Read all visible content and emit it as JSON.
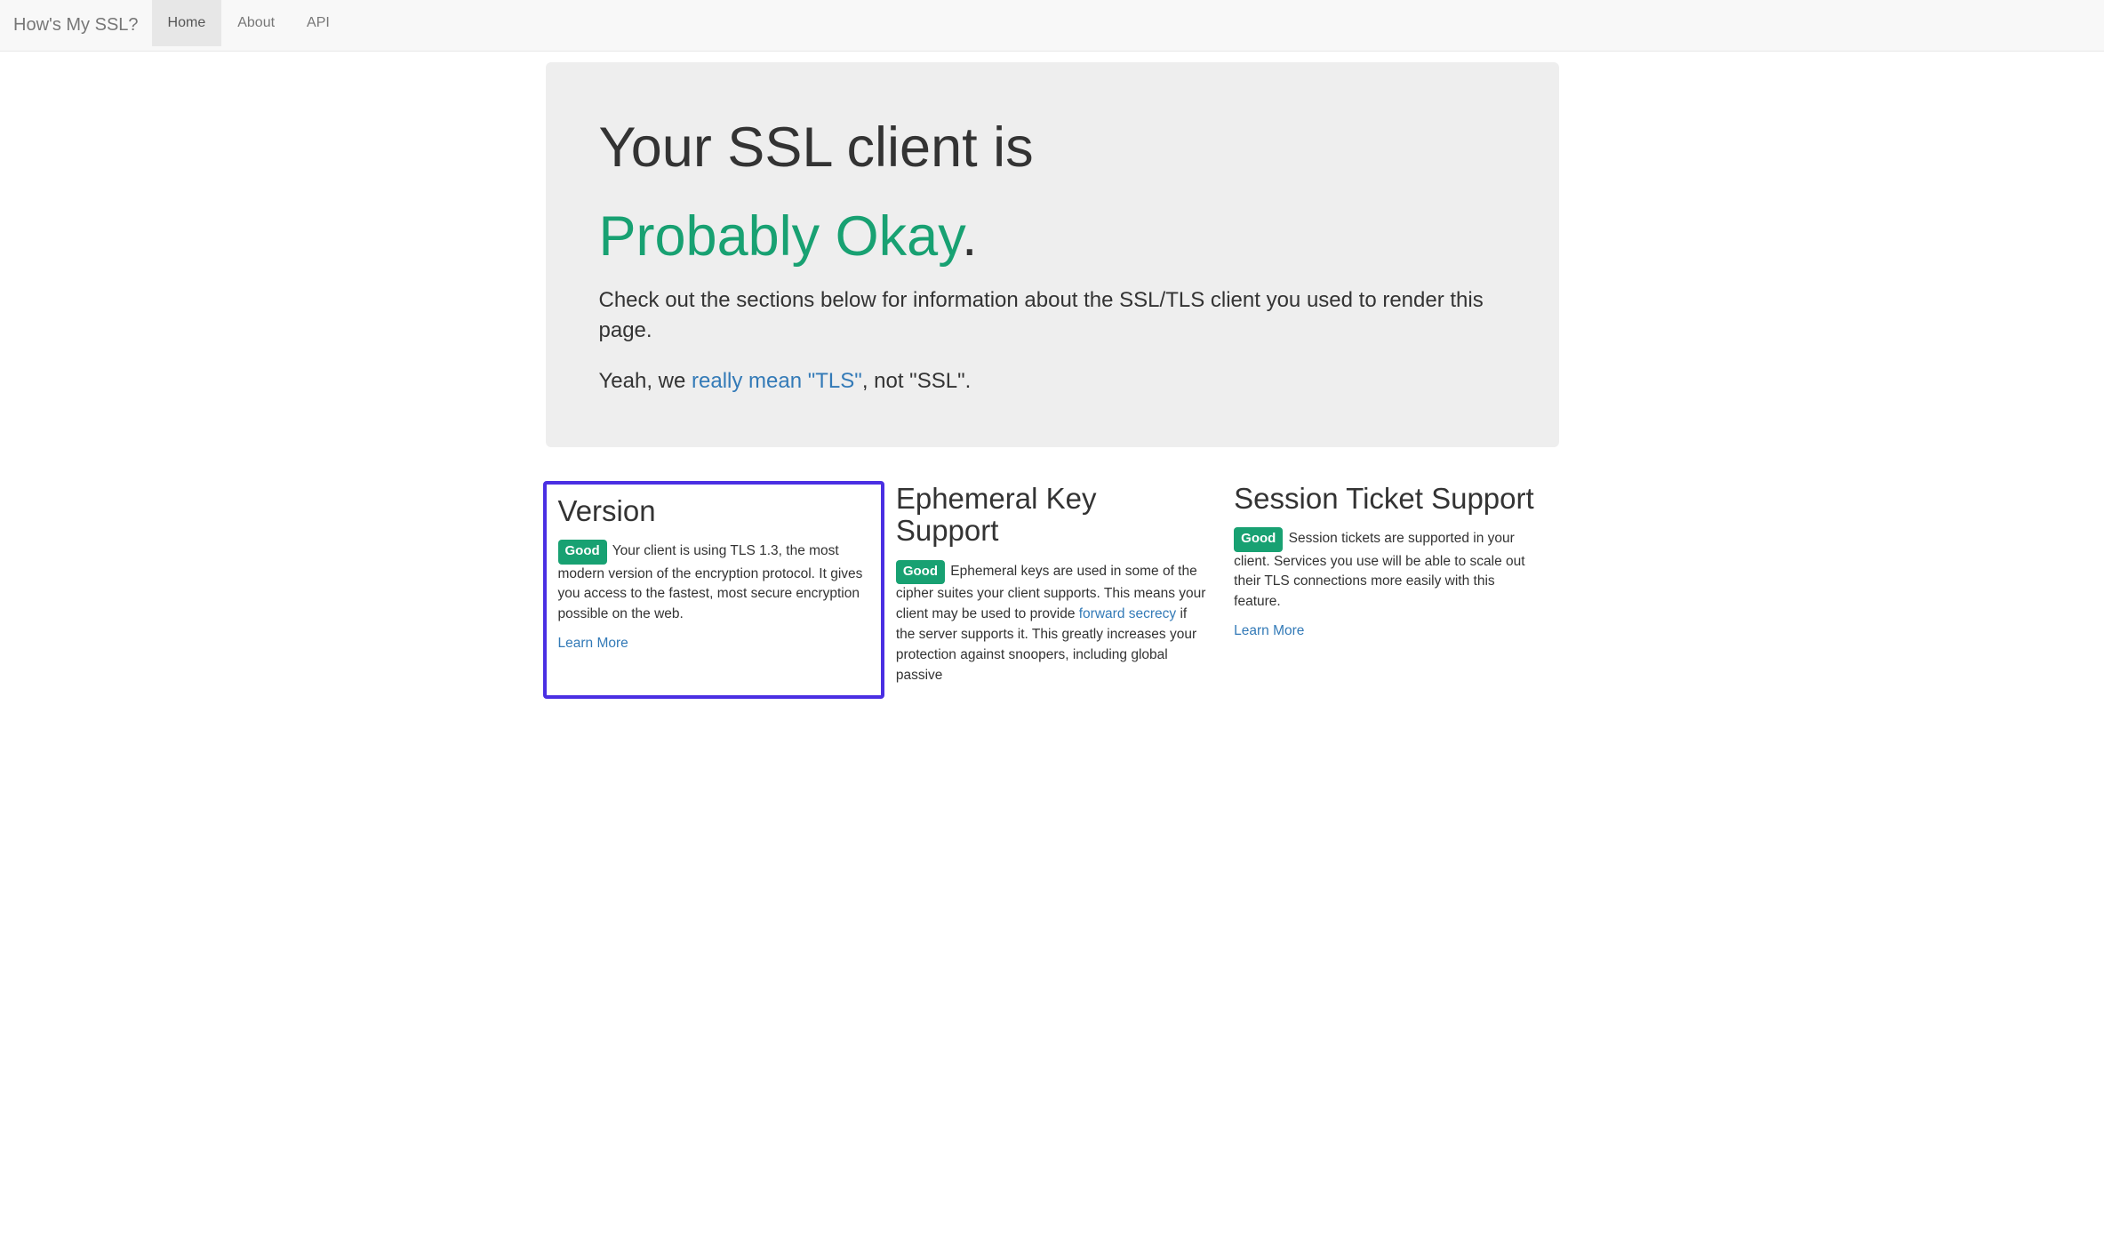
{
  "nav": {
    "brand": "How's My SSL?",
    "items": [
      {
        "label": "Home",
        "active": true
      },
      {
        "label": "About",
        "active": false
      },
      {
        "label": "API",
        "active": false
      }
    ]
  },
  "jumbo": {
    "title_prefix": "Your SSL client is",
    "status": "Probably Okay",
    "period": ".",
    "lead": "Check out the sections below for information about the SSL/TLS client you used to render this page.",
    "sub_prefix": "Yeah, we ",
    "sub_link": "really mean \"TLS\"",
    "sub_suffix": ", not \"SSL\"."
  },
  "sections": {
    "version": {
      "heading": "Version",
      "badge": "Good",
      "body": "Your client is using TLS 1.3, the most modern version of the encryption protocol. It gives you access to the fastest, most secure encryption possible on the web.",
      "learn": "Learn More"
    },
    "ephemeral": {
      "heading": "Ephemeral Key Support",
      "badge": "Good",
      "body_prefix": "Ephemeral keys are used in some of the cipher suites your client supports. This means your client may be used to provide ",
      "body_link": "forward secrecy",
      "body_suffix": " if the server supports it. This greatly increases your protection against snoopers, including global passive"
    },
    "session": {
      "heading": "Session Ticket Support",
      "badge": "Good",
      "body": "Session tickets are supported in your client. Services you use will be able to scale out their TLS connections more easily with this feature.",
      "learn": "Learn More"
    }
  },
  "colors": {
    "ok_green": "#18a172",
    "link_blue": "#337ab7",
    "highlight": "#4a2fe3"
  }
}
